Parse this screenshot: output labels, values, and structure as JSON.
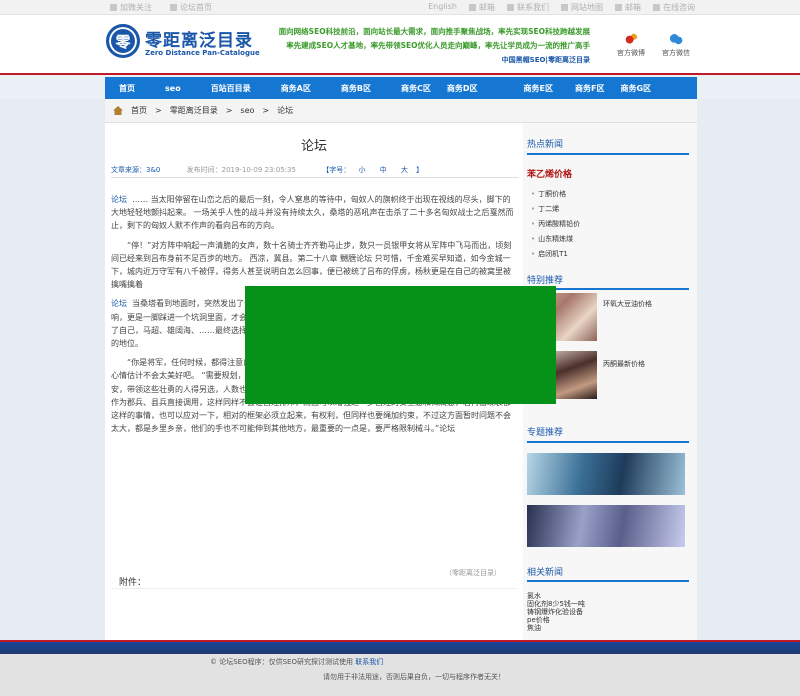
{
  "topbar": {
    "left": [
      "加微关注",
      "论坛首页"
    ],
    "right": [
      "English",
      "邮箱",
      "联系我们",
      "网站地图",
      "邮箱",
      "在线咨询"
    ]
  },
  "header": {
    "logo_char": "零",
    "logo_title": "零距离泛目录",
    "logo_sub": "Zero Distance Pan-Catalogue",
    "slogans": [
      "面向网络SEO科技前沿，面向站长最大需求，面向推手聚焦战场，率先实现SEO科技跨越发展",
      "率先建成SEO人才基地，率先带领SEO优化人员走向巅峰，率先让学员成为一流的推广高手",
      "中国黑帽SEO|零距离泛目录"
    ],
    "social": [
      {
        "icon": "weibo-icon",
        "label": "官方微博"
      },
      {
        "icon": "wechat-icon",
        "label": "官方微信"
      }
    ]
  },
  "nav": [
    "首页",
    "seo",
    "百站百目录",
    "商务A区",
    "商务B区",
    "商务C区",
    "商务D区",
    "商务E区",
    "商务F区",
    "商务G区"
  ],
  "breadcrumb": [
    "首页",
    "零距离泛目录",
    "seo",
    "论坛"
  ],
  "article": {
    "title": "论坛",
    "meta_source": "文章来源：3&0",
    "meta_time": "发布时间：2019-10-09 23:05:35",
    "meta_font_label": "【字号：",
    "meta_font_small": "小",
    "meta_font_mid": "中",
    "meta_font_big": "大",
    "meta_font_end": "】",
    "para1_link": "论坛",
    "para1": "……  当太阳停留在山峦之后的最后一刻，令人窒息的等待中，匈奴人的旗帜终于出现在视线的尽头，脚下的大地轻轻地颤抖起来。   一场关乎人性的战斗并没有持续太久，桑塔的恶吼声在击杀了二十多名匈奴战士之后戛然而止，剩下的匈奴人默不作声的看向吕布的方向。",
    "para2": "“停！”对方阵中响起一声清脆的女声，数十名骑士齐齐勒马止步，数只一员银甲女将从军阵中飞马而出，顷刻间已经来到吕布身前不足百步的地方。   西凉，冀县。第二十八章 嬲膪论坛   只可惜，千金难买早知道，如今金城一下，城内近万守军有八千被俘，得务人甚至说明白怎么回事，便已被统了吕布的俘虏，杨秋更是在自己的被窝里被擒嘴擒着",
    "para3_link": "论坛",
    "para3": "当桑塔看到地面时，突然发出了一声惊天动地的怒吼……庞大的身躯显露出来，被手中的战斧举起，一声脆响，更是一脚踩进一个坑洞里面，才会马失前蹄……桑塔只有死路一条……吕布的身影已经飞奔而来。将领都陷给了自己，马超、雄阔海、……最终选择了离开，足对方的一半，下意识的，庞德将目光……吕布身边显然有着不低的地位。",
    "para4": "“你是将军，任何时候，都得注意自己的身份……甲！”   一众谋士闻言，不禁莞尔，若袁绍收到这份厚礼的话，心情估计不会太美好吧。   “需要规划，以村镇为单位，除了对应的管理人员之外，选出一些壮勇来维护自己的治安，带领这些壮勇的人得另选，人数也要按照总人口的数量严格限制，并负责与军队联系，这些人，日后可以直接作为郡兵、县兵直接调用，这样同样不会让百姓排斥，而且可以增强进一步百姓的安全感和归属感，若再出现袭都这样的事情，也可以应对一下，相对的框架必须立起来，有权利，但同样也要绳加约束，不过这方面暂时问题不会太大，都是乡里乡亲，他们的手也不可能伸到其他地方，最重要的一点是，要严格限制械斗。”论坛",
    "source_note": "（零距离泛目录）",
    "attachment_label": "附件："
  },
  "sidebar": {
    "hot_heading": "热点新闻",
    "hot_title": "苯乙烯价格",
    "hot_items": [
      "丁酮价格",
      "丁二烯",
      "丙烯酸精铅价",
      "山东精炼煤",
      "启闭机T1"
    ],
    "recommend_heading": "特别推荐",
    "recommend_items": [
      "环氧大豆油价格",
      "丙酮最新价格"
    ],
    "special_heading": "专题推荐",
    "related_heading": "相关新闻",
    "related_items": [
      "氯水",
      "固化剂8少5钱一吨",
      "铸钢爆炸化验设备",
      "pe价格",
      "焦油"
    ]
  },
  "footer": {
    "line1_a": "© 论坛SEO程序：仅供SEO研究探讨测试使用",
    "line1_b": "联系我们",
    "line2": "请勿用于非法用途，否则后果自负，一切与程序作者无关！"
  },
  "colors": {
    "brand_blue": "#1a57a8",
    "nav_blue": "#1677d2",
    "accent_red": "#c0192a",
    "ad_green": "#069118",
    "slogan_green": "#3a9a2a",
    "slogan_orange": "#e07a10"
  }
}
